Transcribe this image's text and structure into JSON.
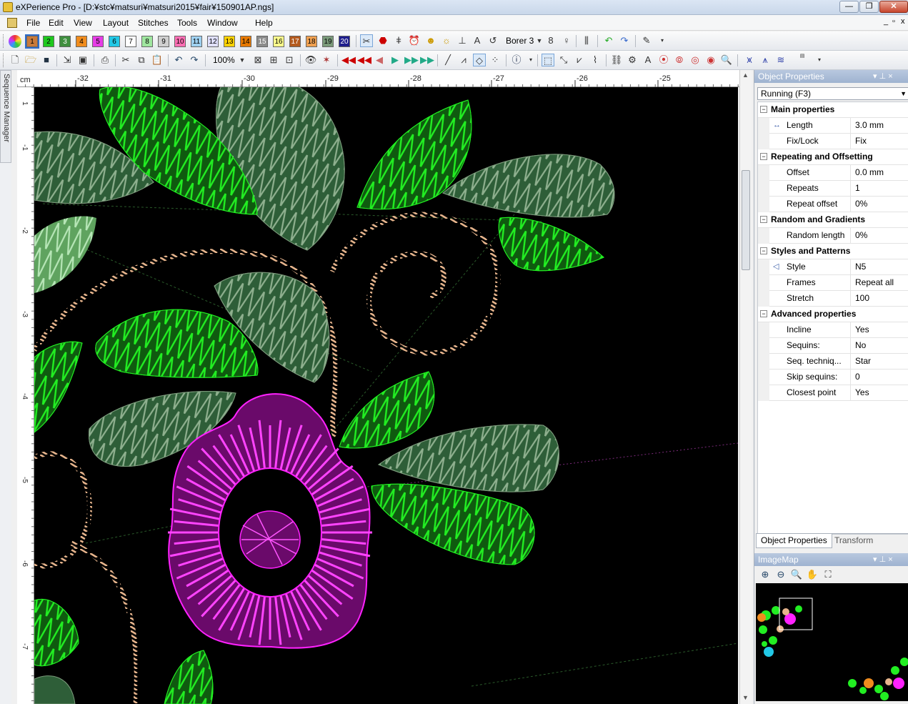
{
  "window": {
    "title": "eXPerience Pro - [D:¥stc¥matsuri¥matsuri2015¥fair¥150901AP.ngs]",
    "minimize_glyph": "—",
    "restore_glyph": "❐",
    "close_glyph": "✕"
  },
  "menu": {
    "items": [
      "File",
      "Edit",
      "View",
      "Layout",
      "Stitches",
      "Tools",
      "Window",
      "Help"
    ],
    "mdi_minimize": "_",
    "mdi_restore": "▫",
    "mdi_close": "x"
  },
  "toolbar1": {
    "color_swatches": [
      {
        "label": "1",
        "color": "#c87a3a"
      },
      {
        "label": "2",
        "color": "#1ec81e"
      },
      {
        "label": "3",
        "color": "#3f8f3f"
      },
      {
        "label": "4",
        "color": "#f08c1e"
      },
      {
        "label": "5",
        "color": "#e63ce6"
      },
      {
        "label": "6",
        "color": "#22c8e6"
      },
      {
        "label": "7",
        "color": "#ffffff"
      },
      {
        "label": "8",
        "color": "#9fe69f"
      },
      {
        "label": "9",
        "color": "#cfcfcf"
      },
      {
        "label": "10",
        "color": "#ff6eb4"
      },
      {
        "label": "11",
        "color": "#9ed0f0"
      },
      {
        "label": "12",
        "color": "#e0e0ff"
      },
      {
        "label": "13",
        "color": "#ffd200"
      },
      {
        "label": "14",
        "color": "#e67800"
      },
      {
        "label": "15",
        "color": "#8c8c8c"
      },
      {
        "label": "16",
        "color": "#ffff8c"
      },
      {
        "label": "17",
        "color": "#b45a1e"
      },
      {
        "label": "18",
        "color": "#f0a050"
      },
      {
        "label": "19",
        "color": "#7a9a7a"
      },
      {
        "label": "20",
        "color": "#1e1e8c"
      }
    ],
    "borer_label": "Borer 3"
  },
  "toolbar2": {
    "zoom": "100%"
  },
  "sidebar": {
    "sequence_manager": "Sequence Manager"
  },
  "rulers": {
    "unit": "cm",
    "h_ticks": [
      "-32",
      "-31",
      "-30",
      "-29",
      "-28",
      "-27",
      "-26",
      "-25"
    ],
    "v_ticks": [
      "1",
      "-1",
      "-2",
      "-3",
      "-4",
      "-5",
      "-6",
      "-7"
    ]
  },
  "object_properties": {
    "header": "Object Properties",
    "header_pin": "▾ ⊥ ×",
    "selector": "Running (F3)",
    "groups": [
      {
        "name": "Main properties",
        "rows": [
          {
            "key": "Length",
            "value": "3.0 mm",
            "icon": "length-icon"
          },
          {
            "key": "Fix/Lock",
            "value": "Fix"
          }
        ]
      },
      {
        "name": "Repeating and Offsetting",
        "rows": [
          {
            "key": "Offset",
            "value": "0.0 mm"
          },
          {
            "key": "Repeats",
            "value": "1"
          },
          {
            "key": "Repeat offset",
            "value": "0%"
          }
        ]
      },
      {
        "name": "Random and Gradients",
        "rows": [
          {
            "key": "Random length",
            "value": "0%"
          }
        ]
      },
      {
        "name": "Styles and Patterns",
        "rows": [
          {
            "key": "Style",
            "value": "N5",
            "icon": "style-icon"
          },
          {
            "key": "Frames",
            "value": "Repeat all"
          },
          {
            "key": "Stretch",
            "value": "100"
          }
        ]
      },
      {
        "name": "Advanced properties",
        "rows": [
          {
            "key": "Incline",
            "value": "Yes"
          },
          {
            "key": "Sequins:",
            "value": "No"
          },
          {
            "key": "Seq. techniq...",
            "value": "Star"
          },
          {
            "key": "Skip sequins:",
            "value": "0"
          },
          {
            "key": "Closest point",
            "value": "Yes"
          }
        ]
      }
    ],
    "tabs": [
      "Object Properties",
      "Transform"
    ]
  },
  "image_map": {
    "header": "ImageMap",
    "header_pin": "▾ ⊥ ×"
  },
  "colors": {
    "leaf_bright": "#22ee22",
    "leaf_dark": "#2e5e38",
    "leaf_dark_stitch": "#8fb08f",
    "flower": "#ff22ff",
    "vine": "#e6b48c",
    "canvas": "#000000"
  }
}
